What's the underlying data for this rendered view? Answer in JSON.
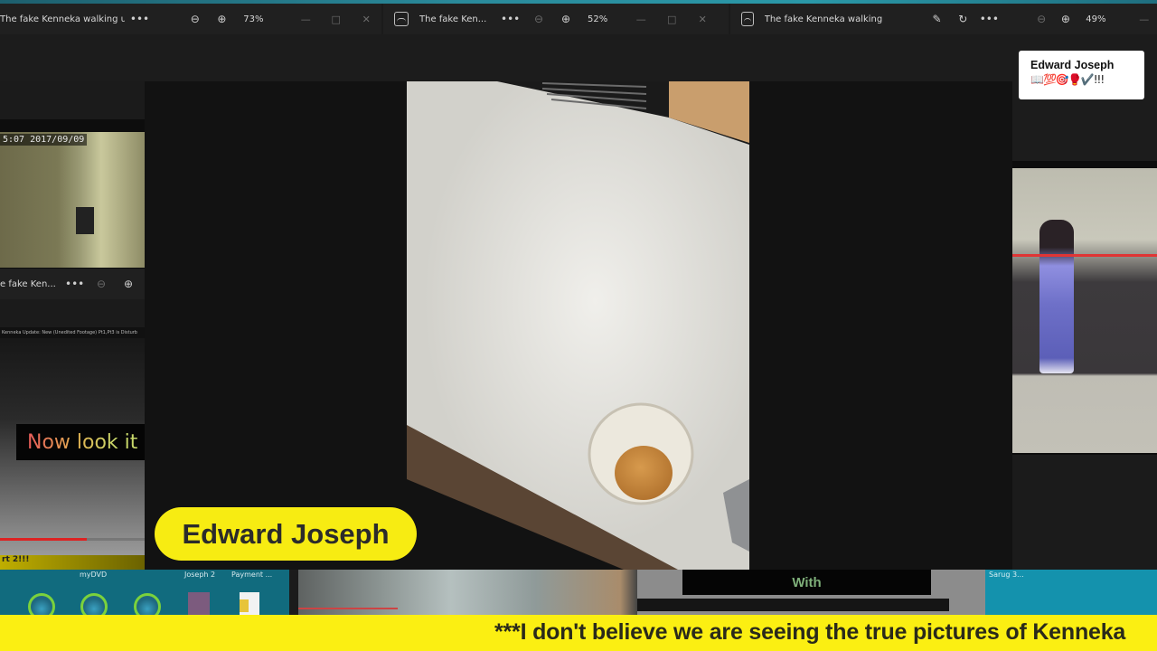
{
  "viewers": [
    {
      "title": "The fake Kenneka walking u...",
      "more": "•••",
      "zoom_out": "⊖",
      "zoom_in": "⊕",
      "zoom_level": "73%",
      "minimize": "—",
      "maximize": "□",
      "close": "✕"
    },
    {
      "title": "The fake Ken...",
      "more": "•••",
      "zoom_out": "⊖",
      "zoom_in": "⊕",
      "zoom_level": "52%",
      "minimize": "—",
      "maximize": "□",
      "close": "✕"
    },
    {
      "title": "The fake Kenneka walking t...",
      "edit": "✎",
      "rotate": "↻",
      "more": "•••",
      "zoom_out": "⊖",
      "zoom_in": "⊕",
      "zoom_level": "49%",
      "minimize": "—"
    }
  ],
  "left_viewer": {
    "timestamp": "5:07  2017/09/09",
    "title": "e fake Ken...",
    "more": "•••",
    "zoom_out": "⊖",
    "zoom_in": "⊕"
  },
  "left_video": {
    "header": "Kenneka Update: New (Unedited Footage) Pt1,Pt3 is Disturb",
    "caption": "Now look it",
    "progress": 0.6,
    "part_label": "rt 2!!!"
  },
  "overlay": {
    "name_pill": "Edward Joseph",
    "card_name": "Edward Joseph",
    "card_emojis": "📖💯🎯🥊✔️!!!",
    "ticker": "***I don't believe we are seeing the true pictures of Kenneka"
  },
  "desktop": {
    "labels": [
      "myDVD",
      "Joseph 2",
      "Payment ..."
    ],
    "right_label": "Sarug 3..."
  },
  "bottom_caption": "With",
  "colors": {
    "accent_yellow": "#fbef12",
    "desktop_teal": "#116b7e",
    "dark_bg": "#121212"
  }
}
